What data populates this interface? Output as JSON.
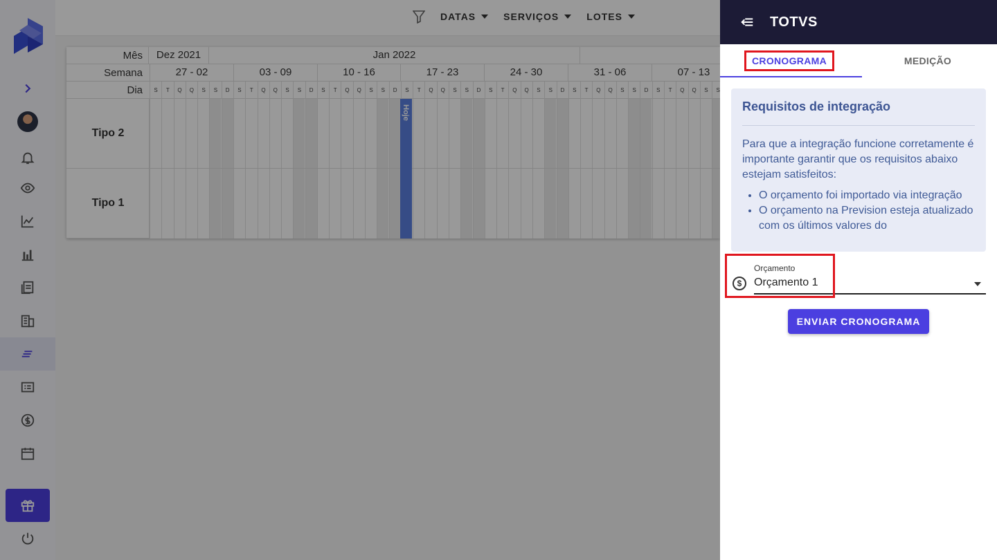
{
  "topbar": {
    "filters": [
      {
        "label": "DATAS"
      },
      {
        "label": "SERVIÇOS"
      },
      {
        "label": "LOTES"
      }
    ]
  },
  "gantt": {
    "labels": {
      "month": "Mês",
      "week": "Semana",
      "day": "Dia"
    },
    "months": [
      {
        "label": "Dez 2021"
      },
      {
        "label": "Jan 2022"
      },
      {
        "label": ""
      }
    ],
    "weeks": [
      "27 - 02",
      "03 - 09",
      "10 - 16",
      "17 - 23",
      "24 - 30",
      "31 - 06",
      "07 - 13"
    ],
    "day_letters": [
      "S",
      "T",
      "Q",
      "Q",
      "S",
      "S",
      "D"
    ],
    "rows": [
      {
        "label": "Tipo 2"
      },
      {
        "label": "Tipo 1"
      }
    ],
    "today_label": "Hoje"
  },
  "drawer": {
    "title": "TOTVS",
    "tabs": [
      {
        "label": "CRONOGRAMA",
        "active": true
      },
      {
        "label": "MEDIÇÃO",
        "active": false
      }
    ],
    "info": {
      "title": "Requisitos de integração",
      "text": "Para que a integração funcione corretamente é importante garantir que os requisitos abaixo estejam satisfeitos:",
      "items": [
        "O orçamento foi importado via integração",
        "O orçamento na Prevision esteja atualizado com os últimos valores do"
      ]
    },
    "field": {
      "label": "Orçamento",
      "value": "Orçamento 1"
    },
    "send_label": "ENVIAR CRONOGRAMA"
  },
  "icons": {
    "money": "$"
  },
  "colors": {
    "accent": "#4b3fe0",
    "drawer_header": "#1c1b36",
    "highlight": "#e0161e",
    "today": "#5b7fe0"
  }
}
